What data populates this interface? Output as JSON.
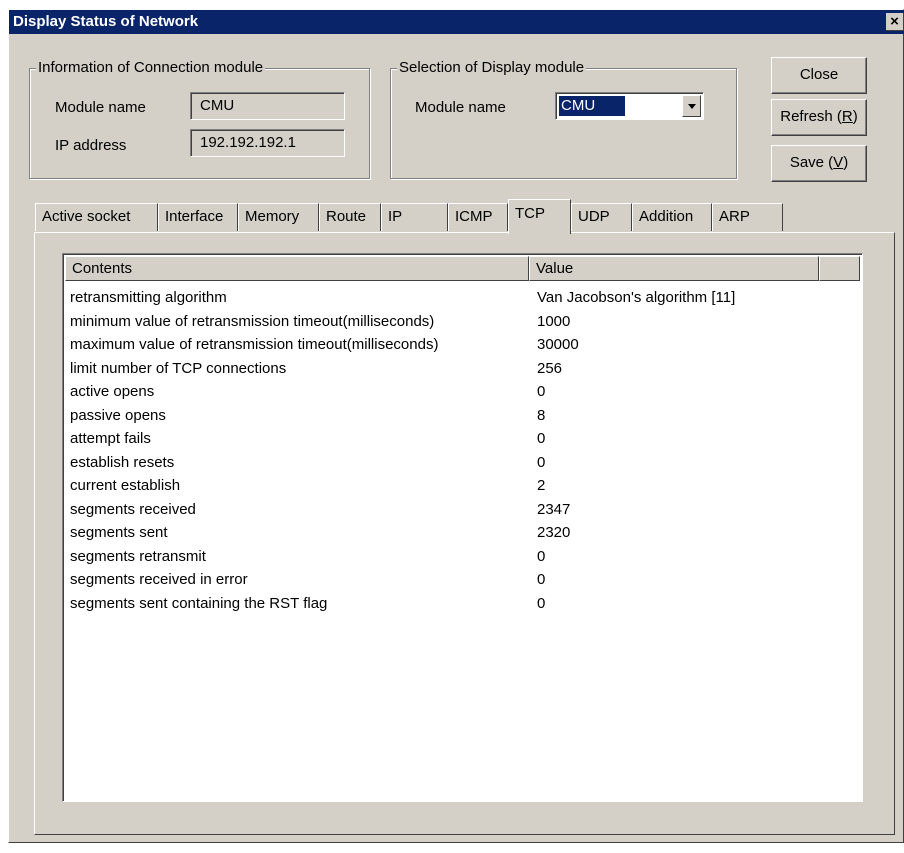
{
  "window": {
    "title": "Display Status of Network",
    "close_glyph": "×"
  },
  "connection_group": {
    "legend": "Information of Connection module",
    "module_name_label": "Module name",
    "module_name_value": "CMU",
    "ip_label": "IP address",
    "ip_value": "192.192.192.1"
  },
  "display_group": {
    "legend": "Selection of Display module",
    "module_name_label": "Module name",
    "selected": "CMU"
  },
  "buttons": {
    "close": "Close",
    "refresh_pre": "Refresh (",
    "refresh_key": "R",
    "refresh_post": ")",
    "save_pre": "Save (",
    "save_key": "V",
    "save_post": ")"
  },
  "tabs": [
    "Active socket",
    "Interface",
    "Memory",
    "Route",
    "IP",
    "ICMP",
    "TCP",
    "UDP",
    "Addition",
    "ARP"
  ],
  "active_tab": "TCP",
  "table": {
    "columns": [
      "Contents",
      "Value"
    ],
    "rows": [
      [
        "retransmitting algorithm",
        "Van Jacobson's algorithm [11]"
      ],
      [
        "minimum value of retransmission timeout(milliseconds)",
        "1000"
      ],
      [
        "maximum value of retransmission timeout(milliseconds)",
        "30000"
      ],
      [
        "limit number of TCP connections",
        "256"
      ],
      [
        "active opens",
        "0"
      ],
      [
        "passive opens",
        "8"
      ],
      [
        "attempt fails",
        "0"
      ],
      [
        "establish resets",
        "0"
      ],
      [
        "current establish",
        "2"
      ],
      [
        "segments received",
        "2347"
      ],
      [
        "segments sent",
        "2320"
      ],
      [
        "segments retransmit",
        "0"
      ],
      [
        "segments received in error",
        "0"
      ],
      [
        "segments sent containing the RST flag",
        "0"
      ]
    ]
  },
  "colors": {
    "titlebar": "#0a246a",
    "face": "#d4d0c8",
    "selection": "#0a246a"
  }
}
